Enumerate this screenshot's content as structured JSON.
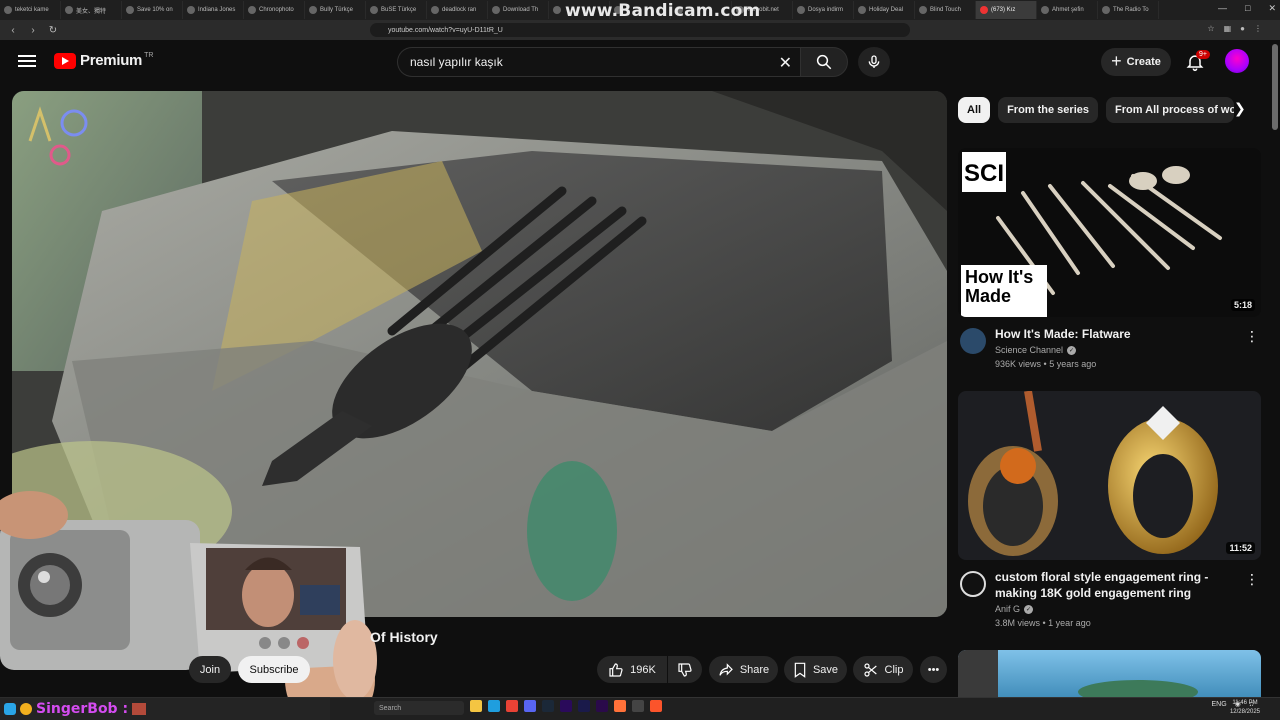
{
  "browser": {
    "watermark": "www.Bandicam.com",
    "tabs": [
      {
        "label": "teketci kame",
        "active": false
      },
      {
        "label": "美女、獨特",
        "active": false
      },
      {
        "label": "Save 10% on",
        "active": false
      },
      {
        "label": "Indiana Jones",
        "active": false
      },
      {
        "label": "Chronophoto",
        "active": false
      },
      {
        "label": "Bully Türkçe",
        "active": false
      },
      {
        "label": "BuSE Türkçe",
        "active": false
      },
      {
        "label": "deadlock ran",
        "active": false
      },
      {
        "label": "Download Th",
        "active": false
      },
      {
        "label": "",
        "active": false
      },
      {
        "label": "",
        "active": false
      },
      {
        "label": "",
        "active": false
      },
      {
        "label": "Turbobit.net",
        "active": false
      },
      {
        "label": "Dosya indirm",
        "active": false
      },
      {
        "label": "Holiday Deal",
        "active": false
      },
      {
        "label": "Blind Touch",
        "active": false
      },
      {
        "label": "(673) Kız",
        "active": true
      },
      {
        "label": "Ahmet şefin",
        "active": false
      },
      {
        "label": "The Radio To",
        "active": false
      }
    ],
    "url": "youtube.com/watch?v=uyU-D11tR_U"
  },
  "header": {
    "logo_text": "Premium",
    "country_code": "TR",
    "search_value": "nasıl yapılır kaşık",
    "create_label": "Create",
    "notification_badge": "9+"
  },
  "video": {
    "title": "Of History",
    "join_label": "Join",
    "subscribe_label": "Subscribe",
    "likes": "196K",
    "share_label": "Share",
    "save_label": "Save",
    "clip_label": "Clip"
  },
  "sidebar": {
    "chips": [
      {
        "label": "All",
        "active": true
      },
      {
        "label": "From the series",
        "active": false
      },
      {
        "label": "From All process of world",
        "active": false
      }
    ],
    "recommendations": [
      {
        "title": "How It's Made: Flatware",
        "channel": "Science Channel",
        "views": "936K views",
        "age": "5 years ago",
        "duration": "5:18",
        "thumb_label_top": "SCI",
        "thumb_label_bottom": "How It's Made"
      },
      {
        "title": "custom floral style engagement ring - making 18K gold engagement ring",
        "channel": "Anif G",
        "views": "3.8M views",
        "age": "1 year ago",
        "duration": "11:52"
      }
    ]
  },
  "overlay": {
    "streamer_name": "SingerBob :"
  },
  "taskbar": {
    "search_placeholder": "Search",
    "lang": "ENG",
    "time": "11:46 PM",
    "date": "12/28/2025"
  }
}
